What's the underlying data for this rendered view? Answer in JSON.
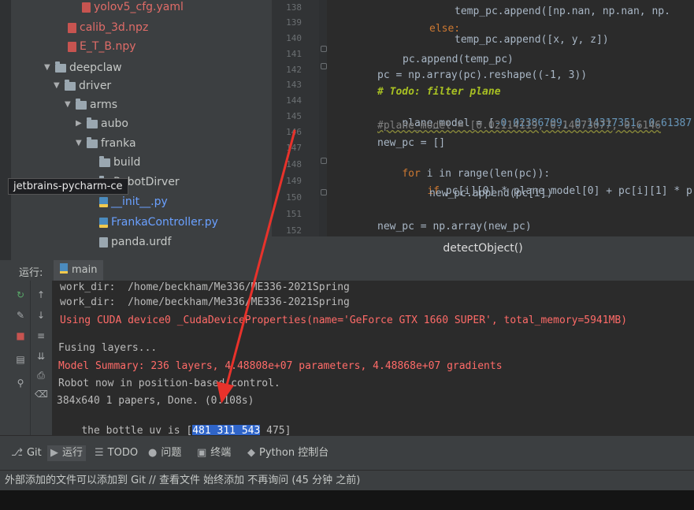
{
  "tooltip": "jetbrains-pycharm-ce",
  "tree": {
    "items": [
      {
        "label": "yolov5_cfg.yaml",
        "kind": "file-red"
      },
      {
        "label": "calib_3d.npz",
        "kind": "file-red"
      },
      {
        "label": "E_T_B.npy",
        "kind": "file-red"
      },
      {
        "label": "deepclaw",
        "kind": "folder"
      },
      {
        "label": "driver",
        "kind": "folder"
      },
      {
        "label": "arms",
        "kind": "folder"
      },
      {
        "label": "aubo",
        "kind": "folder"
      },
      {
        "label": "franka",
        "kind": "folder"
      },
      {
        "label": "build",
        "kind": "folder"
      },
      {
        "label": "RobotDirver",
        "kind": "folder"
      },
      {
        "label": "__init__.py",
        "kind": "file-blue"
      },
      {
        "label": "FrankaController.py",
        "kind": "file-blue"
      },
      {
        "label": "panda.urdf",
        "kind": "file"
      }
    ]
  },
  "editor": {
    "line_numbers": [
      "138",
      "139",
      "140",
      "141",
      "142",
      "143",
      "144",
      "145",
      "146",
      "147",
      "148",
      "149",
      "150",
      "151",
      "152"
    ],
    "lines": [
      {
        "a": "temp_pc.append([np.nan, np.nan, np.",
        "b": ""
      },
      {
        "a": "else:",
        "b": ""
      },
      {
        "a": "temp_pc.append([x, y, z])",
        "b": ""
      },
      {
        "a": "pc.append(temp_pc)",
        "b": ""
      },
      {
        "a": "pc = np.array(pc).reshape((-1, 3))",
        "b": ""
      },
      {
        "a": "# Todo: filter plane",
        "b": ""
      },
      {
        "a": "plane_model = [",
        "b": "-0.02386709, 0.14317351, 0.61387"
      },
      {
        "a": "#plane_model = [0.02114119,-0.14073077,-0.6146",
        "b": ""
      },
      {
        "a": "new_pc = []",
        "b": ""
      },
      {
        "a": "for",
        "b": " i in range(len(pc)):"
      },
      {
        "a": "if",
        "b": " pc[i][0] * plane_model[0] + pc[i][1] * p"
      },
      {
        "a": "new_pc.append(pc[i])",
        "b": ""
      },
      {
        "a": "new_pc = np.array(new_pc)",
        "b": ""
      }
    ],
    "breadcrumb": "detectObject()"
  },
  "run": {
    "label": "运行:",
    "tab": "main",
    "output": [
      "work_dir:  /home/beckham/Me336/ME336-2021Spring",
      "work_dir:  /home/beckham/Me336/ME336-2021Spring",
      "Using CUDA device0 _CudaDeviceProperties(name='GeForce GTX 1660 SUPER', total_memory=5941MB)",
      "Fusing layers...",
      "Model Summary: 236 layers, 4.48808e+07 parameters, 4.48868e+07 gradients",
      "Robot now in position-based control.",
      "384x640 1 papers, Done. (0.108s)",
      "the bottle uv is ["
    ],
    "uv_selected": "481 311 543",
    "uv_rest": " 475]"
  },
  "tool_tabs": [
    "Git",
    "运行",
    "TODO",
    "问题",
    "终端",
    "Python 控制台"
  ],
  "status": "外部添加的文件可以添加到 Git // 查看文件  始终添加  不再询问 (45 分钟 之前)",
  "colors": {
    "accent": "#2f65ca",
    "error": "#ff6b68",
    "arrow": "#e8322b"
  }
}
